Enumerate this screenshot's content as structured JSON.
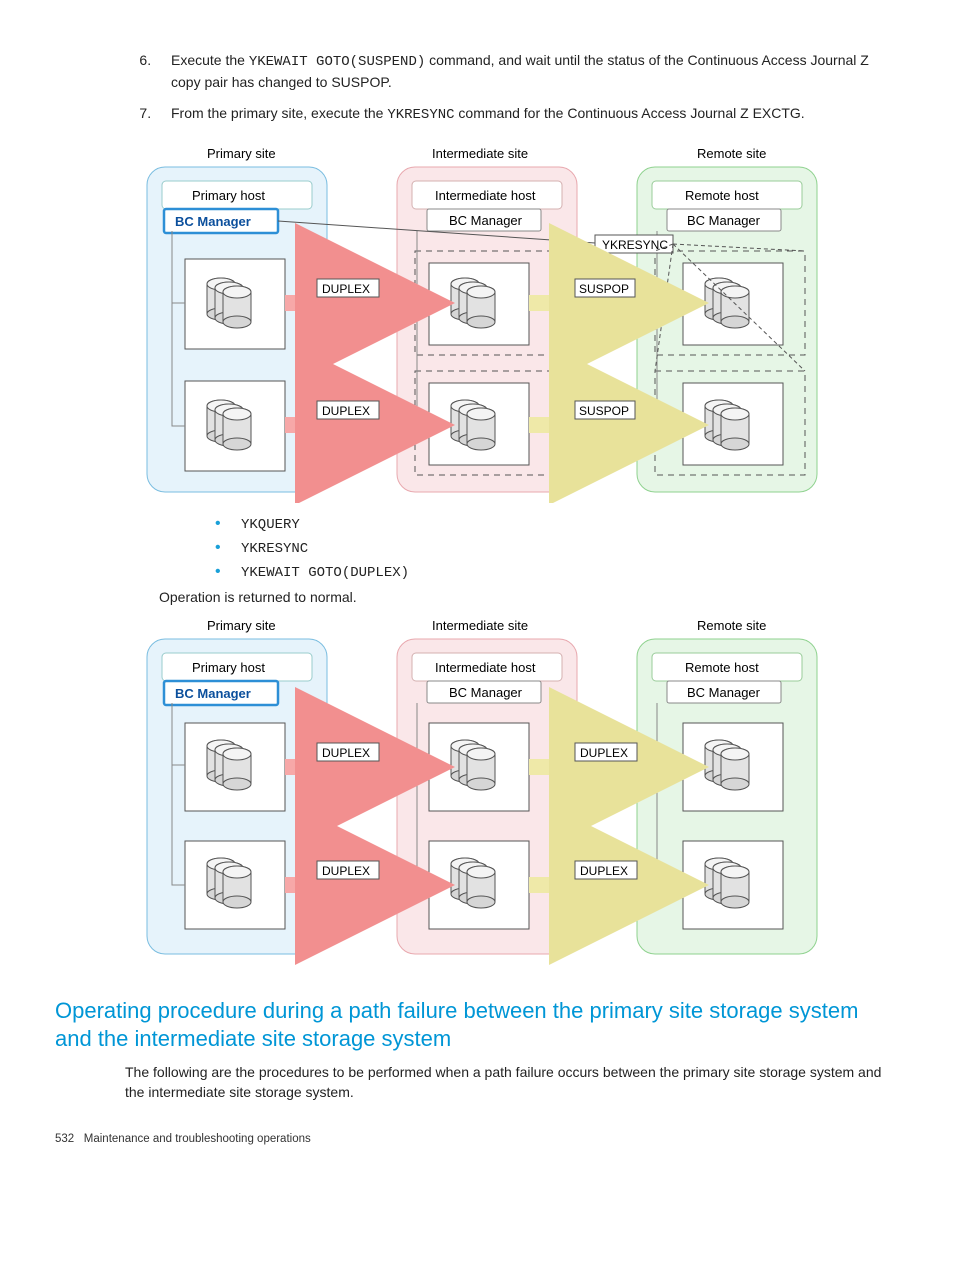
{
  "steps": [
    {
      "num": "6.",
      "pre": "Execute the ",
      "code": "YKEWAIT GOTO(SUSPEND)",
      "post": " command, and wait until the status of the Continuous Access Journal Z copy pair has changed to SUSPOP."
    },
    {
      "num": "7.",
      "pre": "From the primary site, execute the ",
      "code": "YKRESYNC",
      "post": " command for the Continuous Access Journal Z EXCTG."
    }
  ],
  "diagram1": {
    "sites": {
      "primary": "Primary site",
      "intermediate": "Intermediate site",
      "remote": "Remote site"
    },
    "hosts": {
      "primary": "Primary host",
      "intermediate": "Intermediate host",
      "remote": "Remote host"
    },
    "bc_label": "BC Manager",
    "duplex": "DUPLEX",
    "suspop": "SUSPOP",
    "ykresync": "YKRESYNC"
  },
  "bullets": [
    "YKQUERY",
    "YKRESYNC",
    "YKEWAIT GOTO(DUPLEX)"
  ],
  "op_returned": "Operation is returned to normal.",
  "diagram2": {
    "sites": {
      "primary": "Primary site",
      "intermediate": "Intermediate site",
      "remote": "Remote site"
    },
    "hosts": {
      "primary": "Primary host",
      "intermediate": "Intermediate host",
      "remote": "Remote host"
    },
    "bc_label": "BC Manager",
    "duplex": "DUPLEX"
  },
  "section_heading": "Operating procedure during a path failure between the primary site storage system and the intermediate site storage system",
  "section_body": "The following are the procedures to be performed when a path failure occurs between the primary site storage system and the intermediate site storage system.",
  "footer": {
    "page": "532",
    "title": "Maintenance and troubleshooting operations"
  }
}
